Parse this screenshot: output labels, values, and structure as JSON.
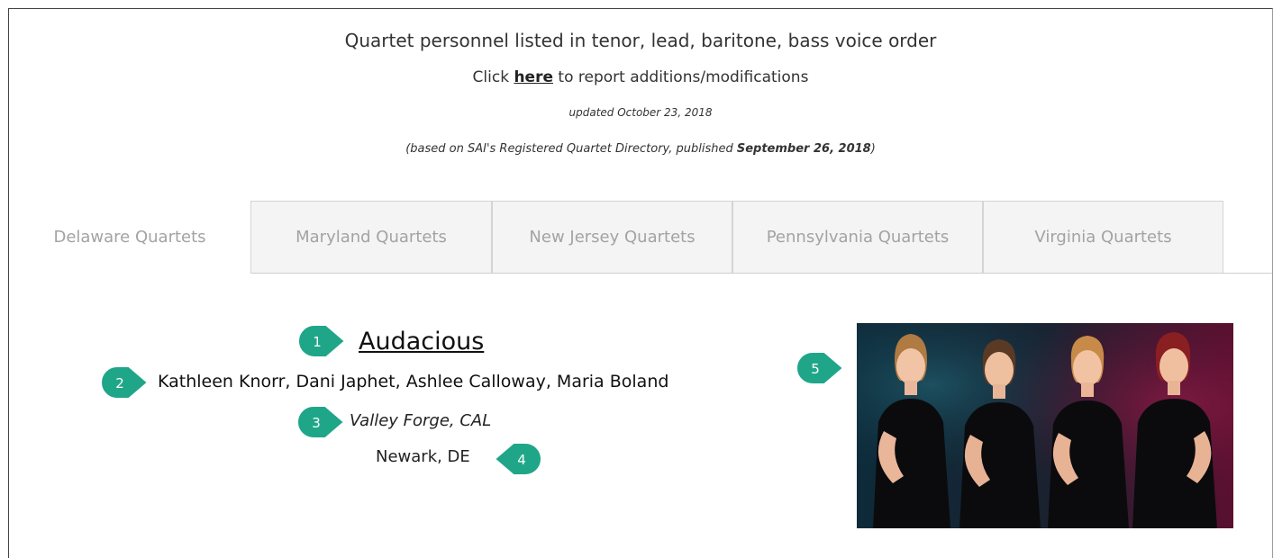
{
  "header": {
    "line1": "Quartet personnel listed in tenor, lead, baritone, bass voice order",
    "line2_prefix": "Click ",
    "line2_link": "here",
    "line2_suffix": " to report additions/modifications",
    "updated": "updated October 23, 2018",
    "based_prefix": "(based on SAI's Registered Quartet Directory, published ",
    "based_date": "September 26, 2018",
    "based_suffix": ")"
  },
  "tabs": [
    {
      "label": "Delaware Quartets",
      "active": true
    },
    {
      "label": "Maryland Quartets",
      "active": false
    },
    {
      "label": "New Jersey Quartets",
      "active": false
    },
    {
      "label": "Pennsylvania Quartets",
      "active": false
    },
    {
      "label": "Virginia Quartets",
      "active": false
    }
  ],
  "quartet": {
    "name": "Audacious",
    "members": "Kathleen Knorr, Dani Japhet, Ashlee Calloway, Maria Boland",
    "district": "Valley Forge, CAL",
    "city": "Newark, DE"
  },
  "markers": [
    "1",
    "2",
    "3",
    "4",
    "5"
  ],
  "colors": {
    "marker": "#1fa688",
    "link": "#222222",
    "tab_text": "#a3a3a3"
  }
}
